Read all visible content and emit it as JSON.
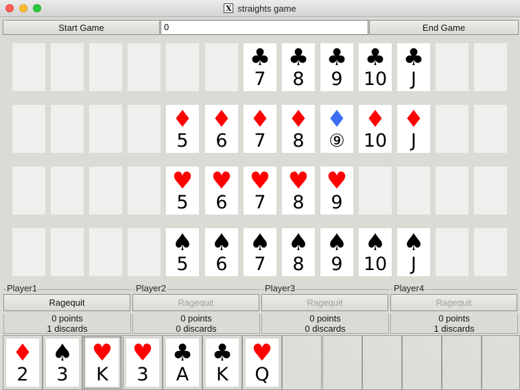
{
  "window": {
    "title": "straights game"
  },
  "toolbar": {
    "start_label": "Start Game",
    "seed_value": "0",
    "end_label": "End Game"
  },
  "colors": {
    "red": "#ff0000",
    "black": "#000000",
    "blue": "#3b6ef5"
  },
  "table": {
    "rows": [
      {
        "suit": "clubs",
        "symbol": "♣",
        "color": "#000000",
        "cells": [
          "",
          "",
          "",
          "",
          "",
          "",
          "7",
          "8",
          "9",
          "10",
          "J",
          "",
          ""
        ]
      },
      {
        "suit": "diamonds",
        "symbol": "♦",
        "color": "#ff0000",
        "cells": [
          "",
          "",
          "",
          "",
          "5",
          "6",
          "7",
          "8",
          "⑨",
          "10",
          "J",
          "",
          ""
        ],
        "highlight": {
          "index": 8,
          "color": "#3b6ef5"
        }
      },
      {
        "suit": "hearts",
        "symbol": "♥",
        "color": "#ff0000",
        "cells": [
          "",
          "",
          "",
          "",
          "5",
          "6",
          "7",
          "8",
          "9",
          "",
          "",
          "",
          ""
        ]
      },
      {
        "suit": "spades",
        "symbol": "♠",
        "color": "#000000",
        "cells": [
          "",
          "",
          "",
          "",
          "5",
          "6",
          "7",
          "8",
          "9",
          "10",
          "J",
          "",
          ""
        ]
      }
    ]
  },
  "players": [
    {
      "name": "Player1",
      "ragequit_label": "Ragequit",
      "enabled": true,
      "points": "0 points",
      "discards": "1 discards"
    },
    {
      "name": "Player2",
      "ragequit_label": "Ragequit",
      "enabled": false,
      "points": "0 points",
      "discards": "0 discards"
    },
    {
      "name": "Player3",
      "ragequit_label": "Ragequit",
      "enabled": false,
      "points": "0 points",
      "discards": "0 discards"
    },
    {
      "name": "Player4",
      "ragequit_label": "Ragequit",
      "enabled": false,
      "points": "0 points",
      "discards": "1 discards"
    }
  ],
  "hand": [
    {
      "rank": "2",
      "symbol": "♦",
      "color": "#ff0000"
    },
    {
      "rank": "3",
      "symbol": "♠",
      "color": "#000000"
    },
    {
      "rank": "K",
      "symbol": "♥",
      "color": "#ff0000",
      "focused": true
    },
    {
      "rank": "3",
      "symbol": "♥",
      "color": "#ff0000"
    },
    {
      "rank": "A",
      "symbol": "♣",
      "color": "#000000"
    },
    {
      "rank": "K",
      "symbol": "♣",
      "color": "#000000"
    },
    {
      "rank": "Q",
      "symbol": "♥",
      "color": "#ff0000"
    },
    null,
    null,
    null,
    null,
    null,
    null
  ]
}
